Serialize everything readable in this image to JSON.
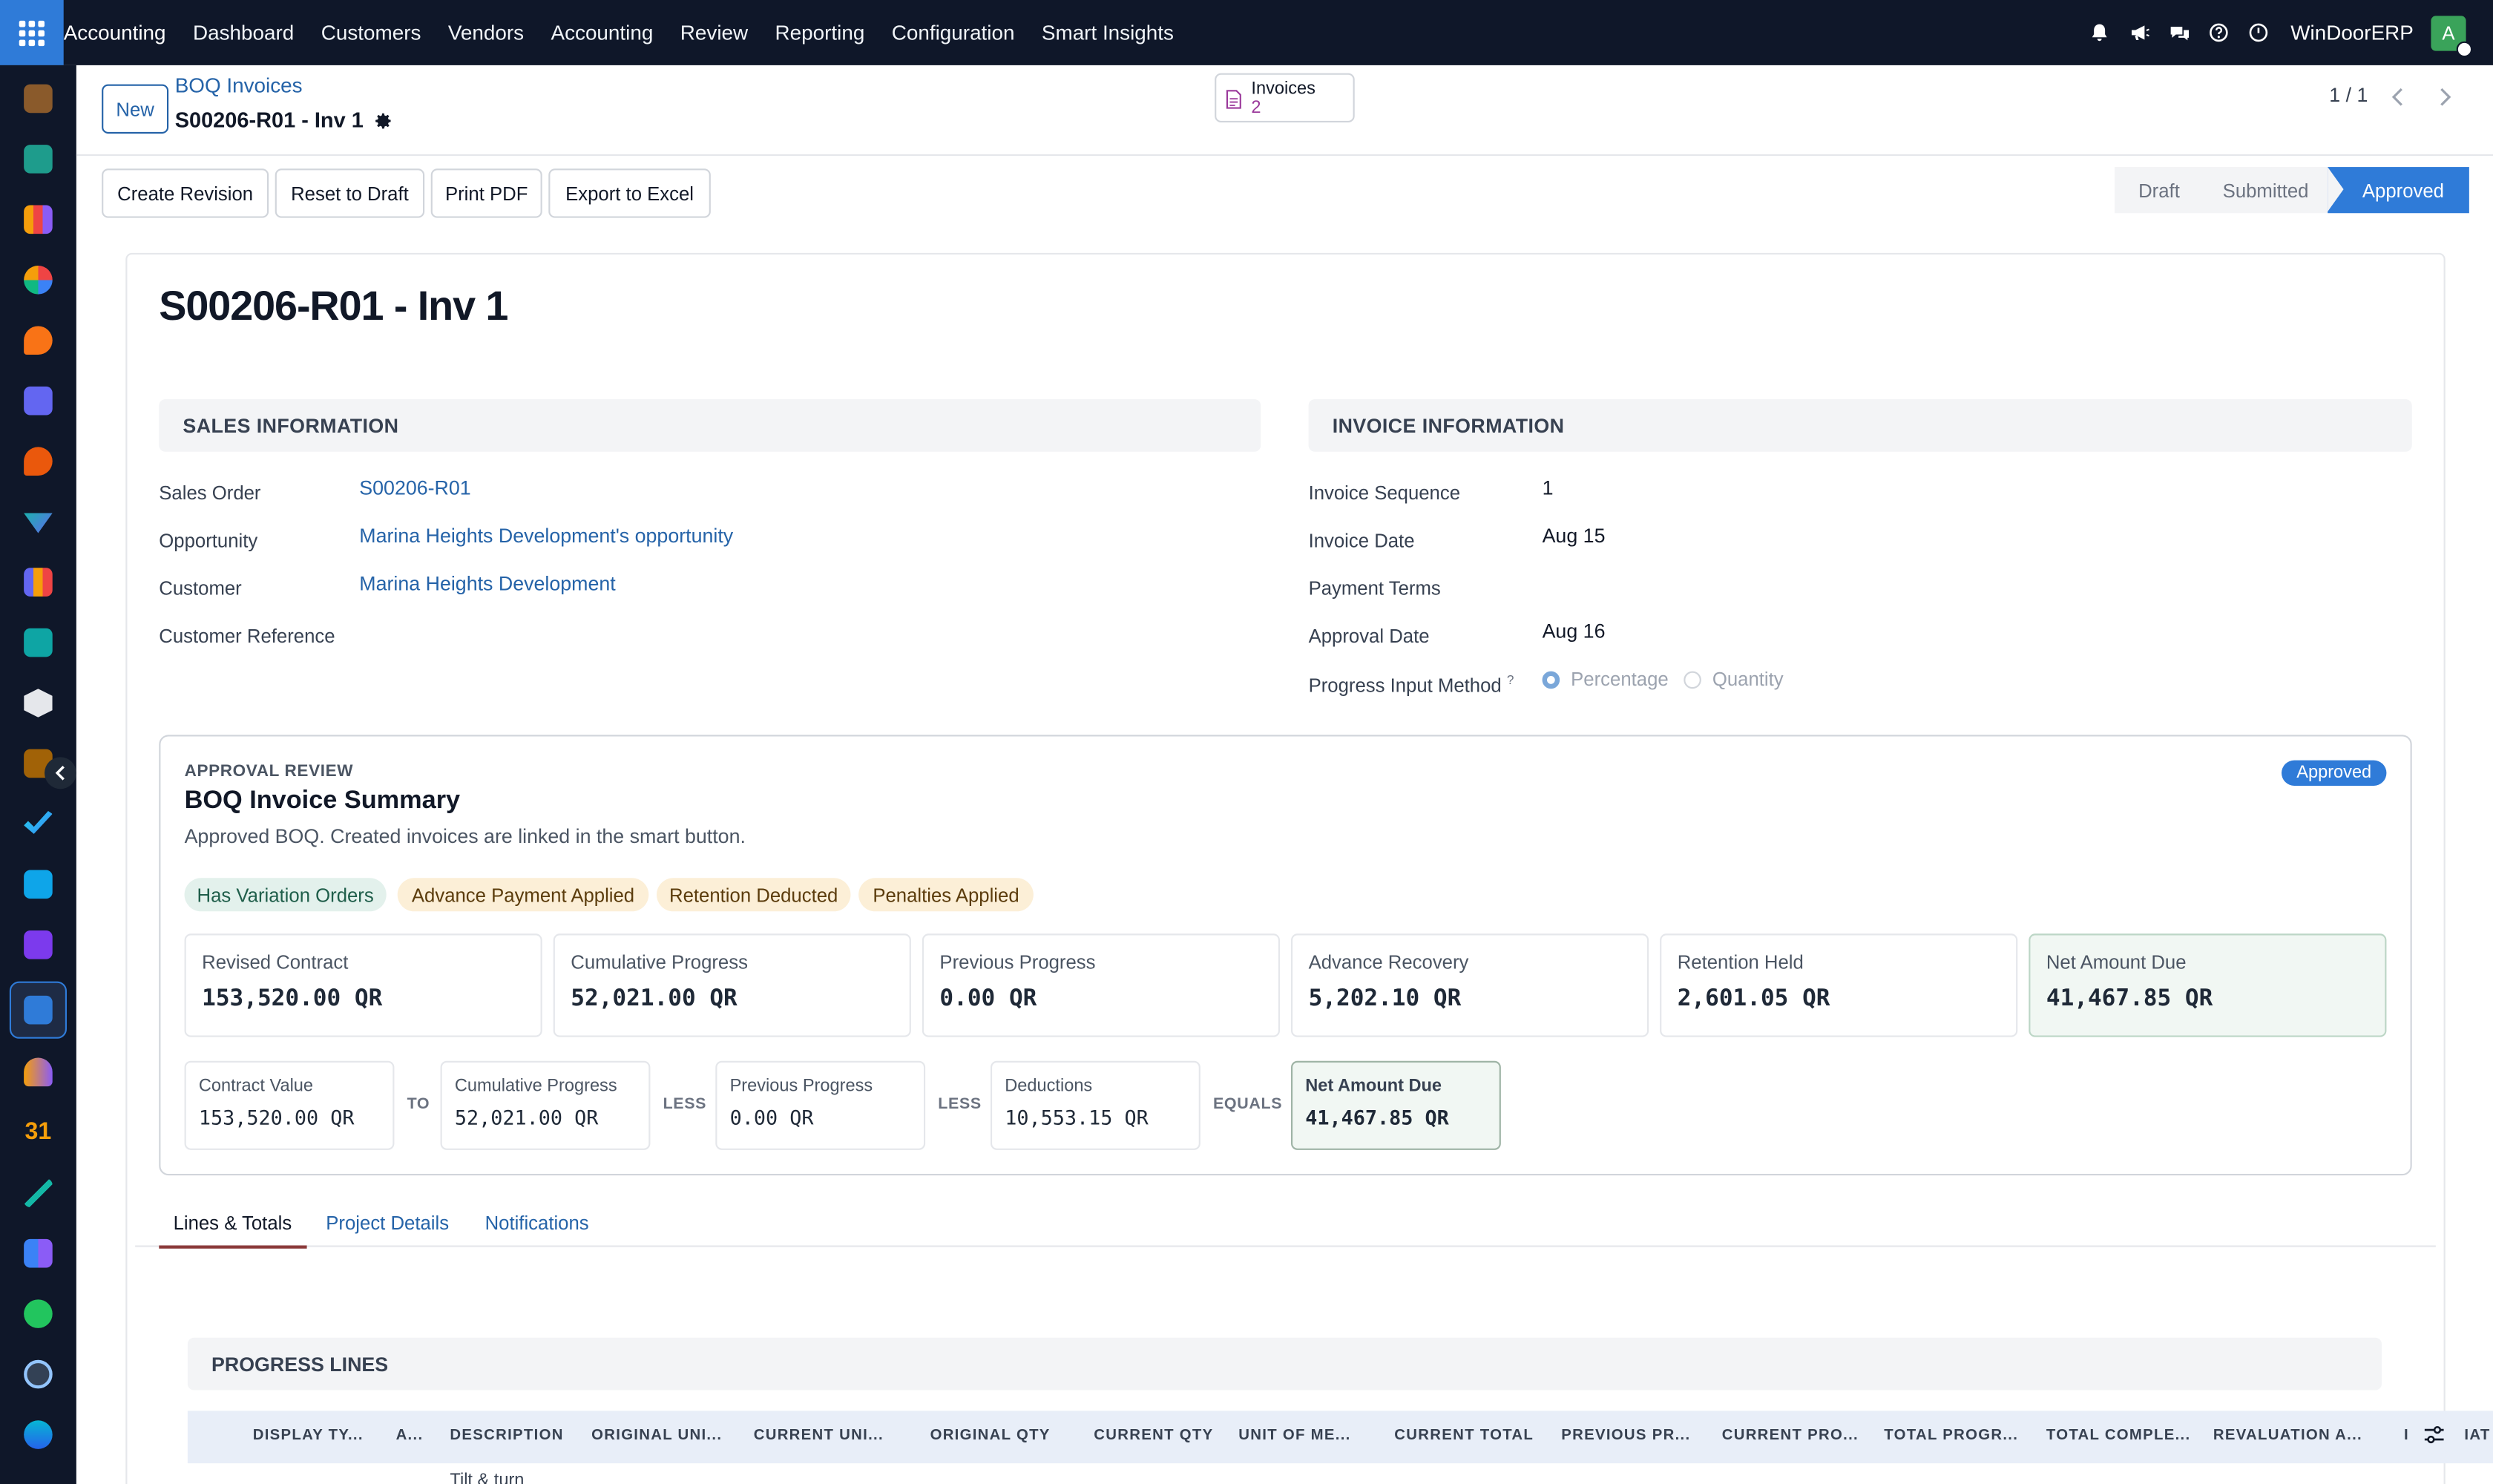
{
  "topbar": {
    "brand": "Accounting",
    "menu": [
      "Dashboard",
      "Customers",
      "Vendors",
      "Accounting",
      "Review",
      "Reporting",
      "Configuration",
      "Smart Insights"
    ],
    "company": "WinDoorERP",
    "avatar_letter": "A"
  },
  "sidebar": {
    "icons": [
      "sketch-app-icon",
      "contacts-app-icon",
      "sales-app-icon",
      "pie-app-icon",
      "discuss-app-icon",
      "mail-app-icon",
      "livechat-app-icon",
      "inventory-app-icon",
      "reports-app-icon",
      "contacts-alt-app-icon",
      "product-app-icon",
      "sketch-alt-app-icon",
      "approvals-app-icon",
      "knowledge-app-icon",
      "packages-app-icon",
      "invoicing-app-icon",
      "employees-app-icon",
      "calendar-app-icon",
      "sign-app-icon",
      "dashboard-app-icon",
      "whatsapp-app-icon",
      "timer-app-icon",
      "sync-app-icon"
    ],
    "calendar_label": "31"
  },
  "control": {
    "new_label": "New",
    "breadcrumb": "BOQ Invoices",
    "record": "S00206-R01 - Inv 1",
    "smart_button": {
      "label": "Invoices",
      "count": "2"
    },
    "pager": "1 / 1"
  },
  "actions": [
    "Create Revision",
    "Reset to Draft",
    "Print PDF",
    "Export to Excel"
  ],
  "statusbar": {
    "states": [
      "Draft",
      "Submitted",
      "Approved"
    ],
    "current": "Approved"
  },
  "form": {
    "title": "S00206-R01 - Inv 1",
    "sales_info": {
      "heading": "SALES INFORMATION",
      "sales_order_label": "Sales Order",
      "sales_order": "S00206-R01",
      "opportunity_label": "Opportunity",
      "opportunity": "Marina Heights Development's opportunity",
      "customer_label": "Customer",
      "customer": "Marina Heights Development",
      "customer_ref_label": "Customer Reference"
    },
    "invoice_info": {
      "heading": "INVOICE INFORMATION",
      "sequence_label": "Invoice Sequence",
      "sequence": "1",
      "date_label": "Invoice Date",
      "date": "Aug 15",
      "terms_label": "Payment Terms",
      "approval_label": "Approval Date",
      "approval": "Aug 16",
      "method_label": "Progress Input Method",
      "method_help": "?",
      "method_options": [
        "Percentage",
        "Quantity"
      ],
      "method_selected": "Percentage"
    }
  },
  "summary": {
    "kicker": "APPROVAL REVIEW",
    "title": "BOQ Invoice Summary",
    "subtitle": "Approved BOQ. Created invoices are linked in the smart button.",
    "badge": "Approved",
    "tags": [
      "Has Variation Orders",
      "Advance Payment Applied",
      "Retention Deducted",
      "Penalties Applied"
    ],
    "kpis": [
      {
        "label": "Revised Contract",
        "value": "153,520.00 QR"
      },
      {
        "label": "Cumulative Progress",
        "value": "52,021.00 QR"
      },
      {
        "label": "Previous Progress",
        "value": "0.00 QR"
      },
      {
        "label": "Advance Recovery",
        "value": "5,202.10 QR"
      },
      {
        "label": "Retention Held",
        "value": "2,601.05 QR"
      },
      {
        "label": "Net Amount Due",
        "value": "41,467.85 QR"
      }
    ],
    "equation": [
      {
        "label": "Contract Value",
        "value": "153,520.00 QR"
      },
      {
        "label": "Cumulative Progress",
        "value": "52,021.00 QR"
      },
      {
        "label": "Previous Progress",
        "value": "0.00 QR"
      },
      {
        "label": "Deductions",
        "value": "10,553.15 QR"
      },
      {
        "label": "Net Amount Due",
        "value": "41,467.85 QR"
      }
    ],
    "operators": [
      "TO",
      "LESS",
      "LESS",
      "EQUALS"
    ]
  },
  "notebook": {
    "tabs": [
      "Lines & Totals",
      "Project Details",
      "Notifications"
    ],
    "active_tab": "Lines & Totals",
    "lines_heading": "PROGRESS LINES",
    "columns": [
      "DISPLAY TY...",
      "A...",
      "DESCRIPTION",
      "ORIGINAL UNI...",
      "CURRENT UNI...",
      "ORIGINAL QTY",
      "CURRENT QTY",
      "UNIT OF ME...",
      "CURRENT TOTAL",
      "PREVIOUS PR...",
      "CURRENT PRO...",
      "TOTAL PROGR...",
      "TOTAL COMPLE...",
      "REVALUATION A...",
      "I",
      "IAT"
    ],
    "first_row_description": "Tilt & turn"
  },
  "colors": {
    "accent": "#2f7bd8",
    "topbar": "#0f1729",
    "link": "#2563a8",
    "net_amount_bg": "#f1f7f3"
  }
}
